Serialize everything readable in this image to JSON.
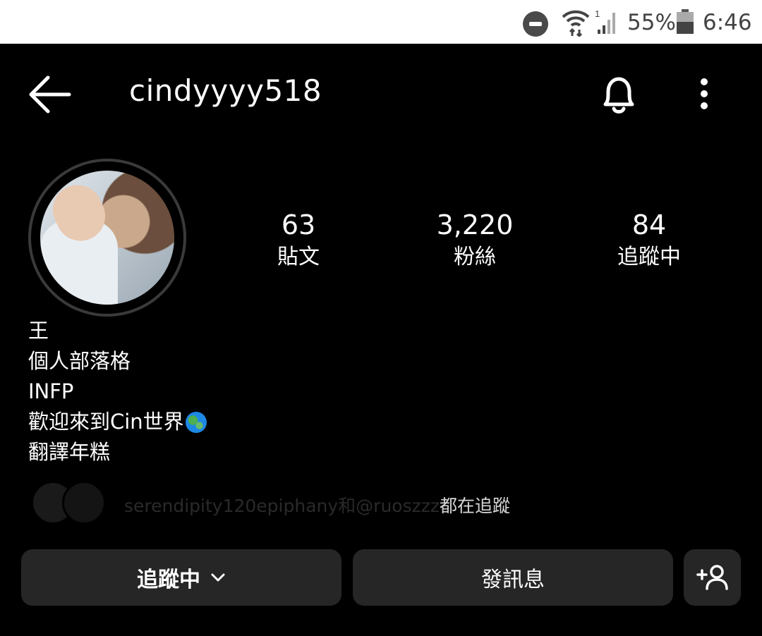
{
  "status_bar": {
    "battery_percent": "55%",
    "time": "6:46",
    "icons": [
      "do-not-disturb-icon",
      "wifi-icon",
      "signal-icon",
      "battery-icon"
    ]
  },
  "header": {
    "username": "cindyyyy518",
    "icons": [
      "back-arrow-icon",
      "bell-icon",
      "more-options-icon"
    ]
  },
  "stats": [
    {
      "value": "63",
      "label": "貼文"
    },
    {
      "value": "3,220",
      "label": "粉絲"
    },
    {
      "value": "84",
      "label": "追蹤中"
    }
  ],
  "bio": {
    "name": "王",
    "category": "個人部落格",
    "line1": "INFP",
    "line2": "歡迎來到Cin世界",
    "line3": "翻譯年糕"
  },
  "followed_by": {
    "names": "serendipity120epiphany和@ruoszzz",
    "suffix": "都在追蹤"
  },
  "buttons": {
    "following": "追蹤中",
    "message": "發訊息"
  },
  "colors": {
    "background": "#000000",
    "button": "#262626",
    "text": "#ffffff"
  }
}
